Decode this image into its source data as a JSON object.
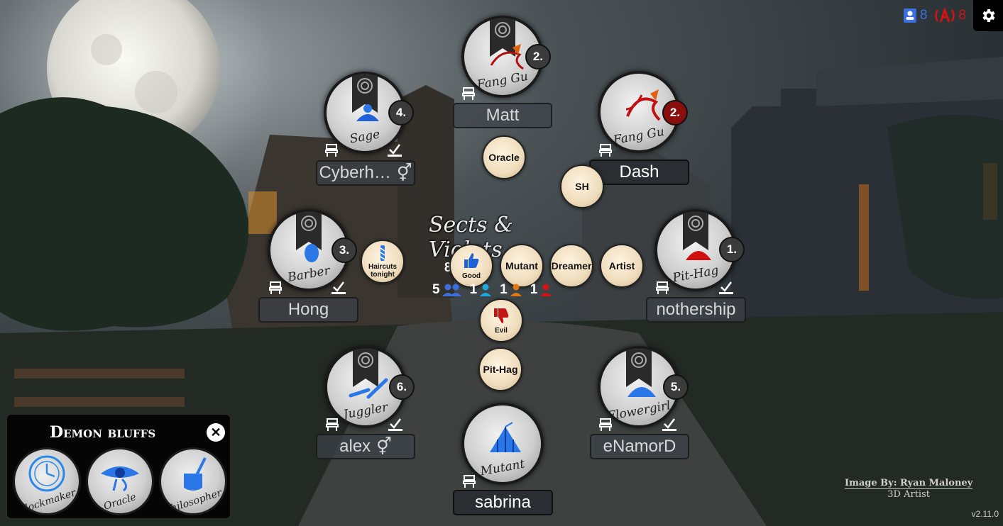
{
  "status": {
    "players_count": "8",
    "spectators_count": "8"
  },
  "script_logo": "Sects & Violets",
  "players": [
    {
      "role": "Fang Gu",
      "seat": "2.",
      "name": "Matt"
    },
    {
      "role": "Sage",
      "seat": "4.",
      "name": "Cyberh…"
    },
    {
      "role": "Fang Gu",
      "seat": "2.",
      "name": "Dash"
    },
    {
      "role": "Barber",
      "seat": "3.",
      "name": "Hong"
    },
    {
      "role": "Pit-Hag",
      "seat": "1.",
      "name": "nothership"
    },
    {
      "role": "Juggler",
      "seat": "6.",
      "name": "alex"
    },
    {
      "role": "Flowergirl",
      "seat": "5.",
      "name": "eNamorD"
    },
    {
      "role": "Mutant",
      "seat": "",
      "name": "sabrina"
    }
  ],
  "reminders": {
    "oracle": "Oracle",
    "sh": "SH",
    "haircuts": "Haircuts tonight",
    "good": "Good",
    "mutant": "Mutant",
    "dreamer": "Dreamer",
    "artist": "Artist",
    "evil": "Evil",
    "pithag": "Pit-Hag"
  },
  "counts": {
    "total": "8",
    "townsfolk": "5",
    "outsiders": "1",
    "minions": "1",
    "demons": "1"
  },
  "bluffs": {
    "title": "Demon bluffs",
    "items": [
      "Clockmaker",
      "Oracle",
      "Philosopher"
    ]
  },
  "credit": {
    "line1": "Image By: Ryan Maloney",
    "line2": "3D Artist"
  },
  "version": "v2.11.0",
  "colors": {
    "good_blue": "#3b6fe0",
    "evil_red": "#d01414",
    "outsider_cyan": "#1fa8e0",
    "minion_orange": "#e07a10"
  }
}
